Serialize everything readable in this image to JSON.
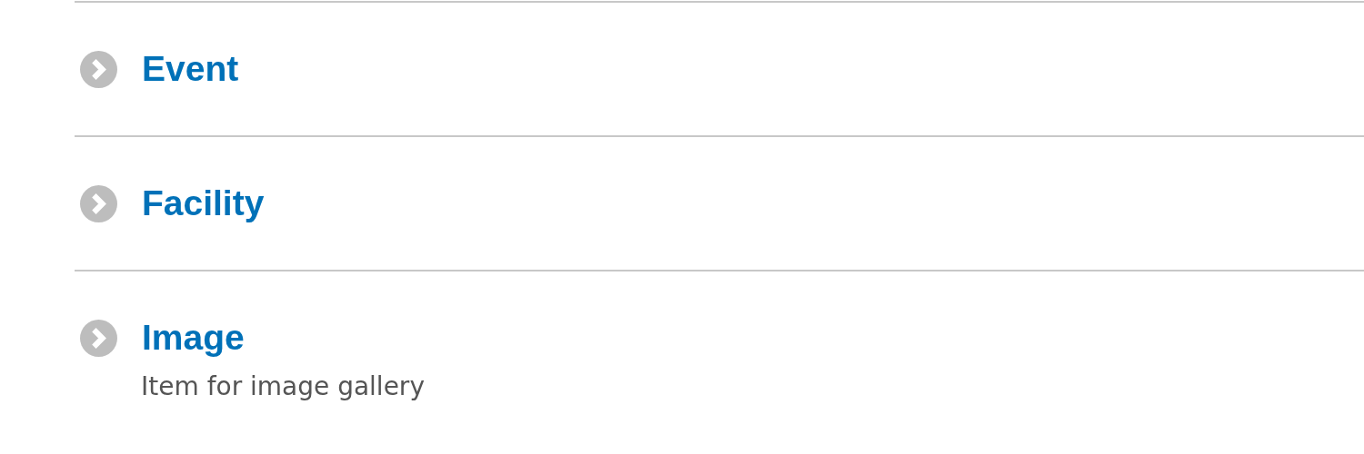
{
  "items": [
    {
      "title": "Event"
    },
    {
      "title": "Facility"
    },
    {
      "title": "Image",
      "description": "Item for image gallery"
    }
  ]
}
